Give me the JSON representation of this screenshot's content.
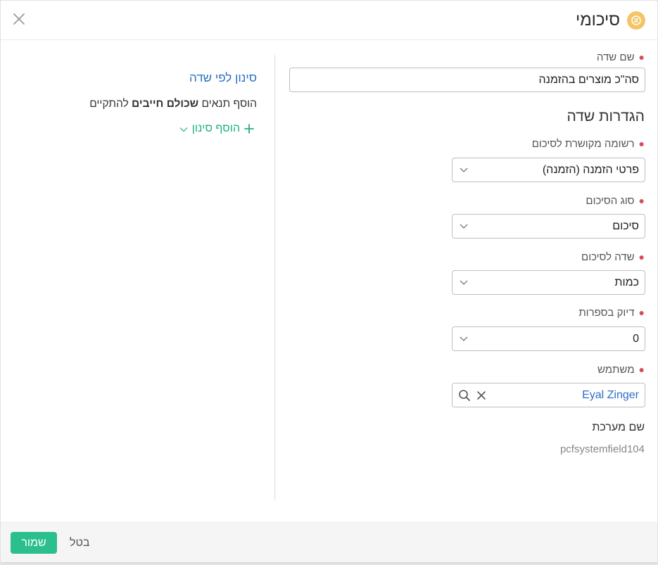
{
  "header": {
    "title": "סיכומי",
    "icon": "summary-icon",
    "accent": "#f3c566"
  },
  "form": {
    "field_name": {
      "label": "שם שדה",
      "value": "סה\"כ מוצרים בהזמנה"
    },
    "section_title": "הגדרות שדה",
    "linked_record": {
      "label": "רשומה מקושרת לסיכום",
      "value": "פרטי הזמנה (הזמנה)"
    },
    "summary_type": {
      "label": "סוג הסיכום",
      "value": "סיכום"
    },
    "summary_field": {
      "label": "שדה לסיכום",
      "value": "כמות"
    },
    "precision": {
      "label": "דיוק בספרות",
      "value": "0"
    },
    "user": {
      "label": "משתמש",
      "value": "Eyal Zinger"
    },
    "system_name": {
      "label": "שם מערכת",
      "value": "pcfsystemfield104"
    }
  },
  "filter": {
    "title": "סינון לפי שדה",
    "desc_before": "הוסף תנאים",
    "desc_bold": "שכולם חייבים",
    "desc_after": "להתקיים",
    "add_label": "הוסף סינון"
  },
  "footer": {
    "save_label": "שמור",
    "cancel_label": "בטל"
  },
  "colors": {
    "primary_green": "#2bbf8e",
    "link_blue": "#2b6fc4",
    "required_red": "#d94b5a"
  }
}
